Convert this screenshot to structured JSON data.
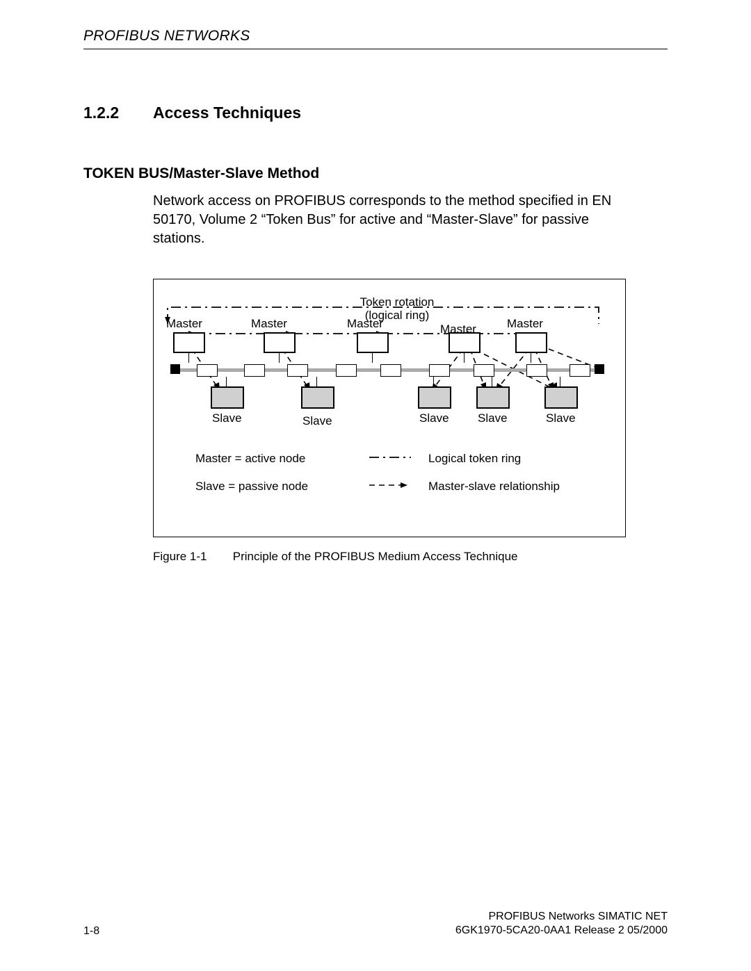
{
  "header": {
    "text": "PROFIBUS NETWORKS"
  },
  "section": {
    "number": "1.2.2",
    "title": "Access Techniques"
  },
  "subheading": "TOKEN BUS/Master-Slave Method",
  "paragraph": "Network access on PROFIBUS corresponds to the method specified in EN 50170, Volume 2 “Token Bus” for active and “Master-Slave” for passive stations.",
  "figure": {
    "token_rotation_line1": "Token rotation",
    "token_rotation_line2": "(logical ring)",
    "masters": [
      "Master",
      "Master",
      "Master",
      "Master",
      "Master"
    ],
    "slaves": [
      "Slave",
      "Slave",
      "Slave",
      "Slave",
      "Slave"
    ],
    "legend": {
      "master_def": "Master = active node",
      "slave_def": "Slave = passive node",
      "token_ring": "Logical token ring",
      "ms_rel": "Master-slave relationship"
    }
  },
  "caption": {
    "label": "Figure 1-1",
    "text": "Principle of the PROFIBUS Medium Access Technique"
  },
  "footer": {
    "page": "1-8",
    "line1": "PROFIBUS Networks SIMATIC NET",
    "line2": "6GK1970-5CA20-0AA1 Release 2 05/2000"
  }
}
